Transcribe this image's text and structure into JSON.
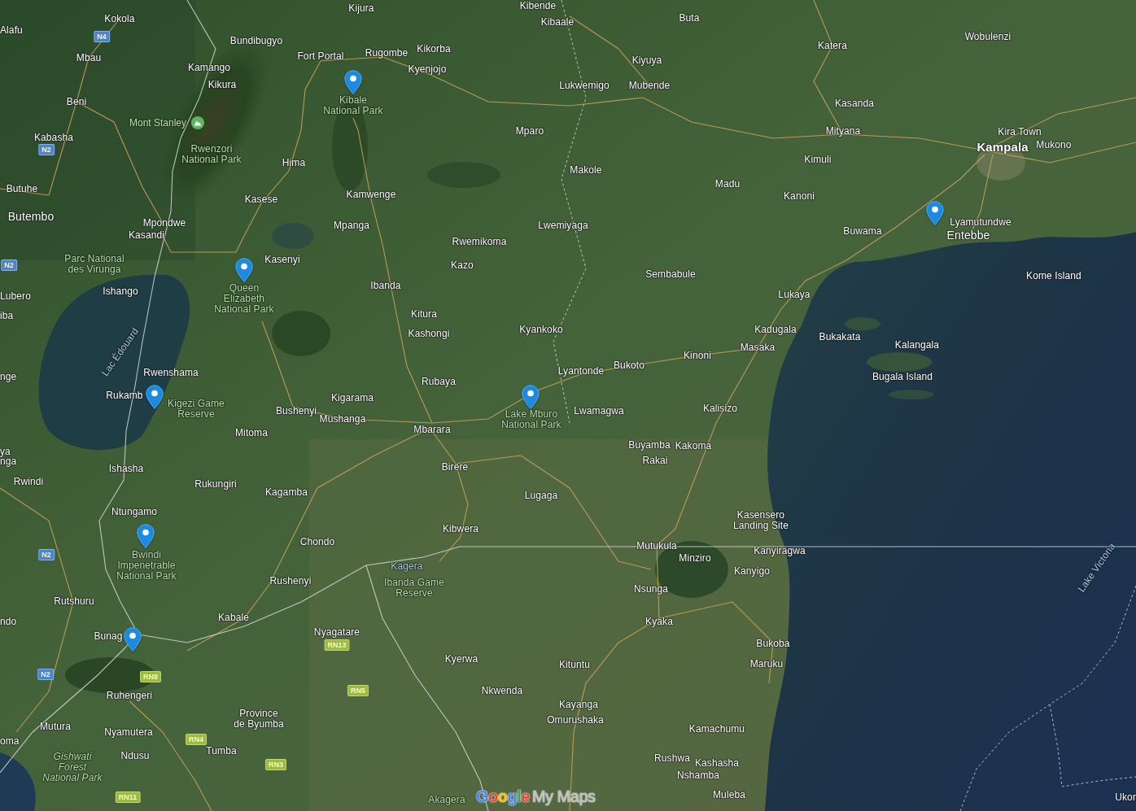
{
  "map": {
    "labels": [
      {
        "kind": "town",
        "text": "Kijura",
        "pinned": false
      },
      {
        "kind": "town",
        "text": "Kibende",
        "pinned": false
      },
      {
        "kind": "town",
        "text": "Kokola",
        "pinned": false
      },
      {
        "kind": "town",
        "text": "Kibaale",
        "pinned": false
      },
      {
        "kind": "town",
        "text": "Buta",
        "pinned": false
      },
      {
        "kind": "town",
        "text": "Alafu",
        "pinned": false
      },
      {
        "kind": "road",
        "text": "N4",
        "color": "#4a84d4",
        "pinned": false
      },
      {
        "kind": "town",
        "text": "Bundibugyo",
        "pinned": false
      },
      {
        "kind": "town",
        "text": "Wobulenzi",
        "pinned": false
      },
      {
        "kind": "town",
        "text": "Kikorba",
        "pinned": false
      },
      {
        "kind": "town",
        "text": "Katera",
        "pinned": false
      },
      {
        "kind": "town",
        "text": "Mbau",
        "pinned": false
      },
      {
        "kind": "town",
        "text": "Fort Portal",
        "pinned": false
      },
      {
        "kind": "town",
        "text": "Rugombe",
        "pinned": false
      },
      {
        "kind": "town",
        "text": "Kamango",
        "pinned": false
      },
      {
        "kind": "town",
        "text": "Kyenjojo",
        "pinned": false
      },
      {
        "kind": "town",
        "text": "Kiyuya",
        "pinned": false
      },
      {
        "kind": "town",
        "text": "Kikura",
        "pinned": false
      },
      {
        "kind": "town",
        "text": "Lukwemigo",
        "pinned": false
      },
      {
        "kind": "town",
        "text": "Mubende",
        "pinned": false
      },
      {
        "kind": "town",
        "text": "Beni",
        "pinned": false
      },
      {
        "kind": "park",
        "lines": [
          "Kibale",
          "National Park"
        ],
        "pinned": true
      },
      {
        "kind": "town",
        "text": "Kasanda",
        "pinned": false
      },
      {
        "kind": "peak",
        "text": "Mont Stanley",
        "pinned": false
      },
      {
        "kind": "town",
        "text": "Kabasha",
        "pinned": false
      },
      {
        "kind": "town",
        "text": "Mparo",
        "pinned": false
      },
      {
        "kind": "town",
        "text": "Mityana",
        "pinned": false
      },
      {
        "kind": "town",
        "text": "Kira Town",
        "pinned": false
      },
      {
        "kind": "road",
        "text": "N2",
        "color": "#4a84d4",
        "pinned": false
      },
      {
        "kind": "park",
        "lines": [
          "Rwenzori",
          "National Park"
        ],
        "pinned": false
      },
      {
        "kind": "city",
        "text": "Kampala",
        "pinned": false
      },
      {
        "kind": "town",
        "text": "Mukono",
        "pinned": false
      },
      {
        "kind": "town",
        "text": "Hima",
        "pinned": false
      },
      {
        "kind": "town",
        "text": "Kimuli",
        "pinned": false
      },
      {
        "kind": "town",
        "text": "Makole",
        "pinned": false
      },
      {
        "kind": "town",
        "text": "Butuhe",
        "pinned": false
      },
      {
        "kind": "town",
        "text": "Madu",
        "pinned": false
      },
      {
        "kind": "town",
        "text": "Kasese",
        "pinned": false
      },
      {
        "kind": "town",
        "text": "Kamwenge",
        "pinned": false
      },
      {
        "kind": "town",
        "text": "Kanoni",
        "pinned": false
      },
      {
        "kind": "large_town",
        "text": "Butembo",
        "pinned": false
      },
      {
        "kind": "town",
        "text": "Mpondwe",
        "pinned": false
      },
      {
        "kind": "town",
        "text": "Mpanga",
        "pinned": false
      },
      {
        "kind": "town",
        "text": "Lwemiyaga",
        "pinned": false
      },
      {
        "kind": "town",
        "text": "Lyamutundwe",
        "pinned": true
      },
      {
        "kind": "town",
        "text": "Kasandi",
        "pinned": false
      },
      {
        "kind": "town",
        "text": "Buwama",
        "pinned": false
      },
      {
        "kind": "town",
        "text": "Rwemikoma",
        "pinned": false
      },
      {
        "kind": "large_town",
        "text": "Entebbe",
        "pinned": false
      },
      {
        "kind": "road",
        "text": "N2",
        "color": "#4a84d4",
        "pinned": false
      },
      {
        "kind": "park",
        "lines": [
          "Parc National",
          "des Virunga"
        ],
        "pinned": false
      },
      {
        "kind": "town",
        "text": "Kasenyi",
        "pinned": false
      },
      {
        "kind": "town",
        "text": "Kazo",
        "pinned": false
      },
      {
        "kind": "town",
        "text": "Sembabule",
        "pinned": false
      },
      {
        "kind": "town",
        "text": "Kome Island",
        "pinned": false
      },
      {
        "kind": "town",
        "text": "Ibanda",
        "pinned": false
      },
      {
        "kind": "town",
        "text": "Lubero",
        "pinned": false
      },
      {
        "kind": "town",
        "text": "Ishango",
        "pinned": false
      },
      {
        "kind": "park",
        "lines": [
          "Queen",
          "Elizabeth",
          "National Park"
        ],
        "pinned": true
      },
      {
        "kind": "town",
        "text": "Lukaya",
        "pinned": false
      },
      {
        "kind": "town",
        "text": "iba",
        "pinned": false
      },
      {
        "kind": "town",
        "text": "Kitura",
        "pinned": false
      },
      {
        "kind": "water",
        "text": "Lac Édouard",
        "pinned": false
      },
      {
        "kind": "town",
        "text": "Kashongi",
        "pinned": false
      },
      {
        "kind": "town",
        "text": "Kyankoko",
        "pinned": false
      },
      {
        "kind": "town",
        "text": "Kadugala",
        "pinned": false
      },
      {
        "kind": "town",
        "text": "Bukakata",
        "pinned": false
      },
      {
        "kind": "town",
        "text": "Masaka",
        "pinned": false
      },
      {
        "kind": "town",
        "text": "Kalangala",
        "pinned": false
      },
      {
        "kind": "town",
        "text": "Kinoni",
        "pinned": false
      },
      {
        "kind": "town",
        "text": "Bukoto",
        "pinned": false
      },
      {
        "kind": "town",
        "text": "nge",
        "pinned": false
      },
      {
        "kind": "town",
        "text": "Rwenshama",
        "pinned": false
      },
      {
        "kind": "town",
        "text": "Lyantonde",
        "pinned": false
      },
      {
        "kind": "town",
        "text": "Rubaya",
        "pinned": false
      },
      {
        "kind": "town",
        "text": "Bugala Island",
        "pinned": false
      },
      {
        "kind": "town",
        "text": "Rukamb",
        "pinned": true
      },
      {
        "kind": "park",
        "lines": [
          "Kigezi Game",
          "Reserve"
        ],
        "pinned": false
      },
      {
        "kind": "town",
        "text": "Kigarama",
        "pinned": false
      },
      {
        "kind": "town",
        "text": "Bushenyi",
        "pinned": false
      },
      {
        "kind": "town",
        "text": "Mushanga",
        "pinned": false
      },
      {
        "kind": "park",
        "lines": [
          "Lake Mburo",
          "National Park"
        ],
        "pinned": true
      },
      {
        "kind": "town",
        "text": "Lwamagwa",
        "pinned": false
      },
      {
        "kind": "town",
        "text": "Kalisizo",
        "pinned": false
      },
      {
        "kind": "town",
        "text": "Mitoma",
        "pinned": false
      },
      {
        "kind": "town",
        "text": "Mbarara",
        "pinned": false
      },
      {
        "kind": "town",
        "text": "ya",
        "pinned": false
      },
      {
        "kind": "town",
        "text": "Buyamba",
        "pinned": false
      },
      {
        "kind": "town",
        "text": "Kakoma",
        "pinned": false
      },
      {
        "kind": "town",
        "text": "nga",
        "pinned": false
      },
      {
        "kind": "town",
        "text": "Ishasha",
        "pinned": false
      },
      {
        "kind": "town",
        "text": "Birere",
        "pinned": false
      },
      {
        "kind": "town",
        "text": "Rakai",
        "pinned": false
      },
      {
        "kind": "town",
        "text": "Rwindi",
        "pinned": false
      },
      {
        "kind": "town",
        "text": "Rukungiri",
        "pinned": false
      },
      {
        "kind": "town",
        "text": "Kagamba",
        "pinned": false
      },
      {
        "kind": "town",
        "text": "Lugaga",
        "pinned": false
      },
      {
        "kind": "town",
        "text": "Ntungamo",
        "pinned": false
      },
      {
        "kind": "town",
        "text": "Kibwera",
        "pinned": false
      },
      {
        "kind": "town",
        "lines": [
          "Kasensero",
          "Landing Site"
        ],
        "pinned": false
      },
      {
        "kind": "town",
        "text": "Chondo",
        "pinned": false
      },
      {
        "kind": "town",
        "text": "Mutukula",
        "pinned": false
      },
      {
        "kind": "road",
        "text": "N2",
        "color": "#4a84d4",
        "pinned": false
      },
      {
        "kind": "park",
        "lines": [
          "Bwindi",
          "Impenetrable",
          "National Park"
        ],
        "pinned": true
      },
      {
        "kind": "water",
        "text": "Kagera",
        "pinned": false
      },
      {
        "kind": "town",
        "text": "Minziro",
        "pinned": false
      },
      {
        "kind": "town",
        "text": "Kanyiragwa",
        "pinned": false
      },
      {
        "kind": "town",
        "text": "Kanyigo",
        "pinned": false
      },
      {
        "kind": "town",
        "text": "Rushenyi",
        "pinned": false
      },
      {
        "kind": "park",
        "lines": [
          "Ibanda Game",
          "Reserve"
        ],
        "pinned": false
      },
      {
        "kind": "town",
        "text": "Nsunga",
        "pinned": false
      },
      {
        "kind": "water",
        "text": "Lake Victoria",
        "pinned": false
      },
      {
        "kind": "town",
        "text": "Rutshuru",
        "pinned": false
      },
      {
        "kind": "town",
        "text": "ndo",
        "pinned": false
      },
      {
        "kind": "town",
        "text": "Kabale",
        "pinned": false
      },
      {
        "kind": "town",
        "text": "Kyaka",
        "pinned": false
      },
      {
        "kind": "town",
        "text": "Bunag",
        "pinned": true
      },
      {
        "kind": "town",
        "text": "Nyagatare",
        "pinned": false
      },
      {
        "kind": "road",
        "text": "RN13",
        "color": "#9bbd3c",
        "pinned": false
      },
      {
        "kind": "town",
        "text": "Bukoba",
        "pinned": false
      },
      {
        "kind": "town",
        "text": "Kyerwa",
        "pinned": false
      },
      {
        "kind": "town",
        "text": "Kituntu",
        "pinned": false
      },
      {
        "kind": "town",
        "text": "Maruku",
        "pinned": false
      },
      {
        "kind": "road",
        "text": "N2",
        "color": "#4a84d4",
        "pinned": false
      },
      {
        "kind": "road",
        "text": "RN8",
        "color": "#9bbd3c",
        "pinned": false
      },
      {
        "kind": "town",
        "text": "Ruhengeri",
        "pinned": false
      },
      {
        "kind": "road",
        "text": "RN5",
        "color": "#9bbd3c",
        "pinned": false
      },
      {
        "kind": "town",
        "text": "Nkwenda",
        "pinned": false
      },
      {
        "kind": "town",
        "text": "Kayanga",
        "pinned": false
      },
      {
        "kind": "town",
        "text": "Mutura",
        "pinned": false
      },
      {
        "kind": "town",
        "text": "Nyamutera",
        "pinned": false
      },
      {
        "kind": "town",
        "lines": [
          "Province",
          "de Byumba"
        ],
        "pinned": false
      },
      {
        "kind": "town",
        "text": "Omurushaka",
        "pinned": false
      },
      {
        "kind": "town",
        "text": "Kamachumu",
        "pinned": false
      },
      {
        "kind": "town",
        "text": "oma",
        "pinned": false
      },
      {
        "kind": "road",
        "text": "RN4",
        "color": "#9bbd3c",
        "pinned": false
      },
      {
        "kind": "forest",
        "lines": [
          "Gishwati",
          "Forest",
          "National Park"
        ],
        "pinned": false
      },
      {
        "kind": "town",
        "text": "Ndusu",
        "pinned": false
      },
      {
        "kind": "town",
        "text": "Tumba",
        "pinned": false
      },
      {
        "kind": "road",
        "text": "RN3",
        "color": "#9bbd3c",
        "pinned": false
      },
      {
        "kind": "town",
        "text": "Rushwa",
        "pinned": false
      },
      {
        "kind": "town",
        "text": "Kashasha",
        "pinned": false
      },
      {
        "kind": "town",
        "text": "Nshamba",
        "pinned": false
      },
      {
        "kind": "road",
        "text": "RN11",
        "color": "#9bbd3c",
        "pinned": false
      },
      {
        "kind": "park",
        "text": "Akagera",
        "pinned": false
      },
      {
        "kind": "town",
        "text": "Muleba",
        "pinned": false
      },
      {
        "kind": "town",
        "text": "Ukor",
        "pinned": false
      }
    ]
  },
  "logo": {
    "wordmark": "Google",
    "product": "My Maps"
  }
}
